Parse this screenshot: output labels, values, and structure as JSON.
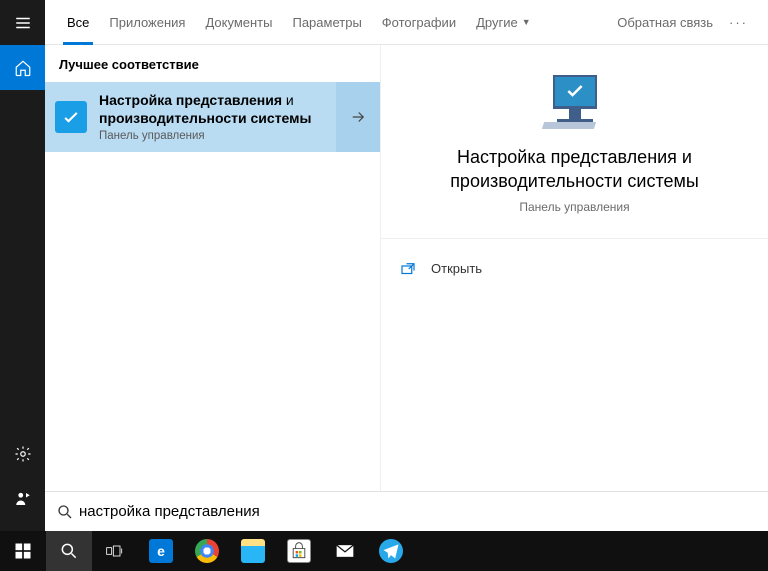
{
  "tabs": {
    "all": "Все",
    "apps": "Приложения",
    "docs": "Документы",
    "settings": "Параметры",
    "photos": "Фотографии",
    "more": "Другие"
  },
  "feedback": "Обратная связь",
  "sections": {
    "best_match": "Лучшее соответствие"
  },
  "result": {
    "title_pre": "Настройка представления",
    "title_conj": " и ",
    "title_post": "производительности системы",
    "sub": "Панель управления"
  },
  "preview": {
    "title": "Настройка представления и производительности системы",
    "sub": "Панель управления"
  },
  "actions": {
    "open": "Открыть"
  },
  "search": {
    "value": "настройка представления"
  }
}
